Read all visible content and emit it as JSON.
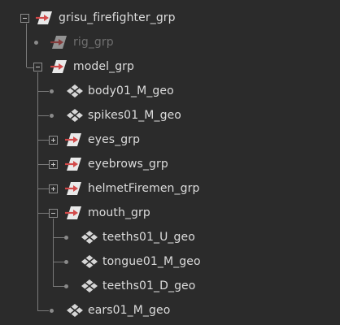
{
  "outliner": {
    "items": [
      {
        "label": "grisu_firefighter_grp",
        "icon": "transform-group-icon",
        "expander": "collapse",
        "dimmed": false
      },
      {
        "label": "rig_grp",
        "icon": "transform-group-icon",
        "expander": "none",
        "dimmed": true
      },
      {
        "label": "model_grp",
        "icon": "transform-group-icon",
        "expander": "collapse",
        "dimmed": false
      },
      {
        "label": "body01_M_geo",
        "icon": "mesh-icon",
        "expander": "none",
        "dimmed": false
      },
      {
        "label": "spikes01_M_geo",
        "icon": "mesh-icon",
        "expander": "none",
        "dimmed": false
      },
      {
        "label": "eyes_grp",
        "icon": "transform-group-icon",
        "expander": "expand",
        "dimmed": false
      },
      {
        "label": "eyebrows_grp",
        "icon": "transform-group-icon",
        "expander": "expand",
        "dimmed": false
      },
      {
        "label": "helmetFiremen_grp",
        "icon": "transform-group-icon",
        "expander": "expand",
        "dimmed": false
      },
      {
        "label": "mouth_grp",
        "icon": "transform-group-icon",
        "expander": "collapse",
        "dimmed": false
      },
      {
        "label": "teeths01_U_geo",
        "icon": "mesh-icon",
        "expander": "none",
        "dimmed": false
      },
      {
        "label": "tongue01_M_geo",
        "icon": "mesh-icon",
        "expander": "none",
        "dimmed": false
      },
      {
        "label": "teeths01_D_geo",
        "icon": "mesh-icon",
        "expander": "none",
        "dimmed": false
      },
      {
        "label": "ears01_M_geo",
        "icon": "mesh-icon",
        "expander": "none",
        "dimmed": false
      }
    ]
  },
  "colors": {
    "background": "#2b2b2b",
    "text": "#dcdcdc",
    "dimmed_text": "#6f6f6f",
    "arrow_red": "#d24a4a",
    "connector": "#7a7a7a"
  }
}
